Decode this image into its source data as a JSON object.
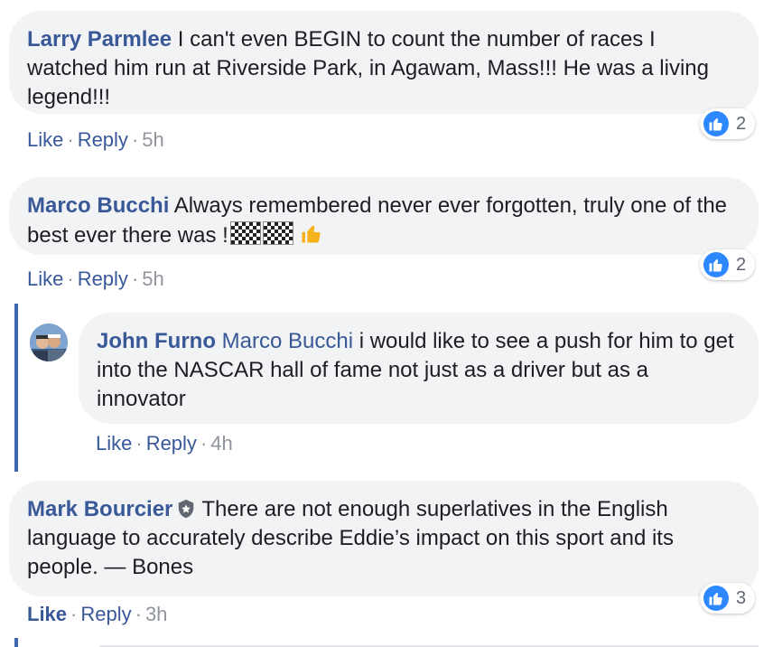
{
  "comments": [
    {
      "author": "Larry Parmlee",
      "text": "I can't even BEGIN to count the number of races I watched him run at Riverside Park, in Agawam, Mass!!! He was a living legend!!!",
      "like_label": "Like",
      "reply_label": "Reply",
      "time": "5h",
      "reaction_count": "2"
    },
    {
      "author": "Marco Bucchi",
      "text": "Always remembered never ever forgotten, truly one of the best ever there was !",
      "like_label": "Like",
      "reply_label": "Reply",
      "time": "5h",
      "reaction_count": "2",
      "emojis": [
        "chequered-flag",
        "chequered-flag",
        "thumbs-up"
      ]
    },
    {
      "author": "Mark Bourcier",
      "text": "There are not enough superlatives in the English language to accurately describe Eddie’s impact on this sport and its people. — Bones",
      "like_label": "Like",
      "reply_label": "Reply",
      "time": "3h",
      "reaction_count": "3",
      "liked": true,
      "badge_icon": "shield-icon"
    }
  ],
  "reply": {
    "author": "John Furno",
    "mention": "Marco Bucchi",
    "text": "i would like to see a push for him to get into the NASCAR hall of fame not just as a driver but as a innovator",
    "like_label": "Like",
    "reply_label": "Reply",
    "time": "4h"
  },
  "colors": {
    "link": "#385898",
    "bubble": "#f2f3f5",
    "thread_line": "#4267b2",
    "like_badge": "#2d88ff",
    "meta": "#90949c"
  }
}
